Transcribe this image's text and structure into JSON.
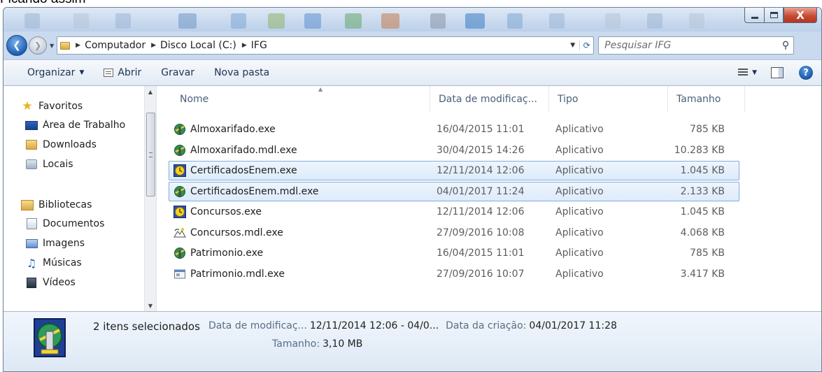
{
  "caption": "Ficando assim",
  "window_controls": {
    "close_glyph": "X"
  },
  "address": {
    "crumbs": [
      "Computador",
      "Disco Local (C:)",
      "IFG"
    ]
  },
  "search": {
    "placeholder": "Pesquisar IFG"
  },
  "toolbar": {
    "organize": "Organizar",
    "open": "Abrir",
    "burn": "Gravar",
    "new_folder": "Nova pasta",
    "help_glyph": "?"
  },
  "nav": {
    "favorites": "Favoritos",
    "desktop": "Área de Trabalho",
    "downloads": "Downloads",
    "recent": "Locais",
    "libraries": "Bibliotecas",
    "documents": "Documentos",
    "pictures": "Imagens",
    "music": "Músicas",
    "videos": "Vídeos"
  },
  "columns": {
    "name": "Nome",
    "date": "Data de modificaç...",
    "type": "Tipo",
    "size": "Tamanho"
  },
  "files": [
    {
      "name": "Almoxarifado.exe",
      "date": "16/04/2015 11:01",
      "type": "Aplicativo",
      "size": "785 KB",
      "icon": "green-figure-icon",
      "selected": false
    },
    {
      "name": "Almoxarifado.mdl.exe",
      "date": "30/04/2015 14:26",
      "type": "Aplicativo",
      "size": "10.283 KB",
      "icon": "green-figure-icon",
      "selected": false
    },
    {
      "name": "CertificadosEnem.exe",
      "date": "12/11/2014 12:06",
      "type": "Aplicativo",
      "size": "1.045 KB",
      "icon": "yellow-clock-icon",
      "selected": true
    },
    {
      "name": "CertificadosEnem.mdl.exe",
      "date": "04/01/2017 11:24",
      "type": "Aplicativo",
      "size": "2.133 KB",
      "icon": "green-figure-icon",
      "selected": true
    },
    {
      "name": "Concursos.exe",
      "date": "12/11/2014 12:06",
      "type": "Aplicativo",
      "size": "1.045 KB",
      "icon": "yellow-clock-icon",
      "selected": false
    },
    {
      "name": "Concursos.mdl.exe",
      "date": "27/09/2016 10:08",
      "type": "Aplicativo",
      "size": "4.068 KB",
      "icon": "landscape-icon",
      "selected": false
    },
    {
      "name": "Patrimonio.exe",
      "date": "16/04/2015 11:01",
      "type": "Aplicativo",
      "size": "785 KB",
      "icon": "green-figure-icon",
      "selected": false
    },
    {
      "name": "Patrimonio.mdl.exe",
      "date": "27/09/2016 10:07",
      "type": "Aplicativo",
      "size": "3.417 KB",
      "icon": "generic-app-icon",
      "selected": false
    }
  ],
  "details": {
    "selection_count": "2 itens selecionados",
    "modified_label": "Data de modificaç...",
    "modified_value": "12/11/2014 12:06 - 04/0...",
    "created_label": "Data da criação:",
    "created_value": "04/01/2017 11:28",
    "size_label": "Tamanho:",
    "size_value": "3,10 MB"
  },
  "colors": {
    "selection_bg": "#dcebfc",
    "selection_border": "#84acdd",
    "close_button": "#c84c36"
  }
}
